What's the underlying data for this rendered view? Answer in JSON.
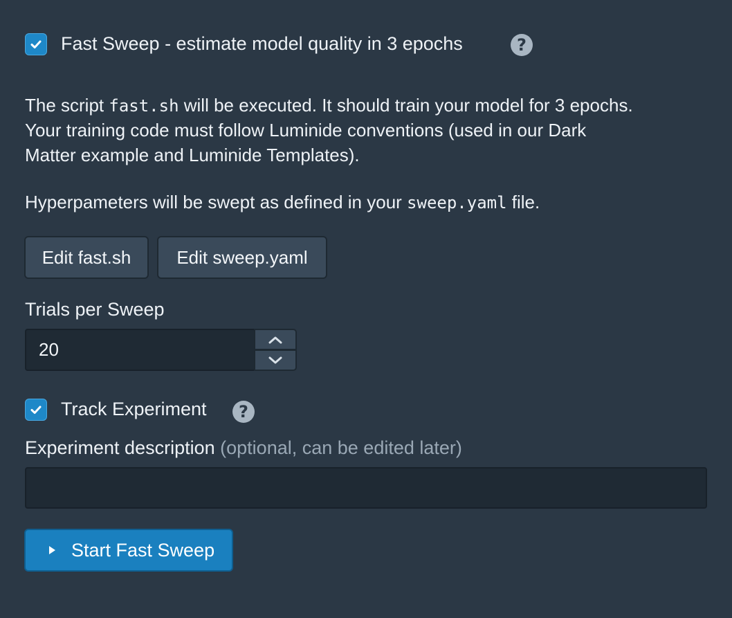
{
  "fast_sweep": {
    "checked": true,
    "label": "Fast Sweep - estimate model quality in 3 epochs",
    "help_icon": "question-circle-icon"
  },
  "description": {
    "line1_prefix": "The script ",
    "line1_code": "fast.sh",
    "line1_suffix": " will be executed. It should train your model for 3 epochs.",
    "line2": "Your training code must follow Luminide conventions (used in our Dark",
    "line3": "Matter example and Luminide Templates).",
    "hyper_prefix": "Hyperpameters will be swept as defined in your ",
    "hyper_code": "sweep.yaml",
    "hyper_suffix": " file."
  },
  "buttons": {
    "edit_fast": "Edit fast.sh",
    "edit_sweep": "Edit sweep.yaml"
  },
  "trials": {
    "label": "Trials per Sweep",
    "value": "20"
  },
  "track": {
    "checked": true,
    "label": "Track Experiment",
    "help_icon": "question-circle-icon"
  },
  "experiment": {
    "label": "Experiment description",
    "hint": "(optional, can be edited later)",
    "value": "",
    "placeholder": ""
  },
  "start": {
    "label": "Start Fast Sweep",
    "icon": "play-triangle-icon"
  },
  "colors": {
    "background": "#2b3845",
    "accent": "#1a80bf",
    "button": "#3a4a5a",
    "input": "#1f2a34"
  }
}
